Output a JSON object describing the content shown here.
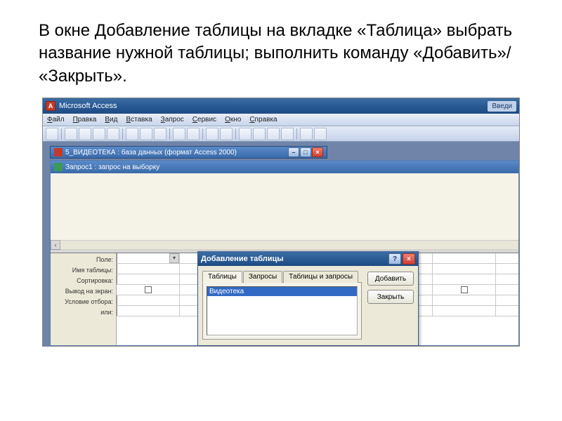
{
  "slide": {
    "text": "В окне Добавление таблицы на вкладке «Таблица» выбрать название нужной таблицы; выполнить команду «Добавить»/ «Закрыть»."
  },
  "access": {
    "title": "Microsoft Access",
    "type_question": "Введи"
  },
  "menu": {
    "items": [
      "Файл",
      "Правка",
      "Вид",
      "Вставка",
      "Запрос",
      "Сервис",
      "Окно",
      "Справка"
    ]
  },
  "db_window": {
    "title": "5_ВИДЕОТЕКА : база данных (формат Access 2000)"
  },
  "query_window": {
    "title": "Запрос1 : запрос на выборку"
  },
  "grid_labels": {
    "field": "Поле:",
    "table": "Имя таблицы:",
    "sort": "Сортировка:",
    "show": "Вывод на экран:",
    "criteria": "Условие отбора:",
    "or": "или:"
  },
  "dialog": {
    "title": "Добавление таблицы",
    "tabs": [
      "Таблицы",
      "Запросы",
      "Таблицы и запросы"
    ],
    "list_item": "Видеотека",
    "add_btn": "Добавить",
    "close_btn": "Закрыть"
  }
}
